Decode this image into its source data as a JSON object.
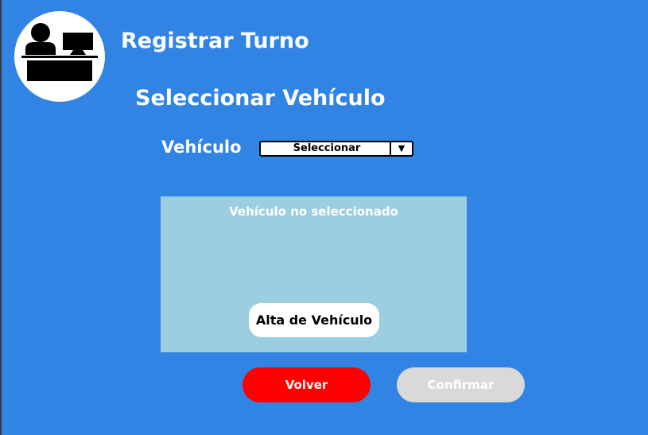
{
  "header": {
    "logo_icon": "receptionist-desk-icon",
    "title": "Registrar Turno"
  },
  "section": {
    "title": "Seleccionar Vehículo"
  },
  "vehicle_field": {
    "label": "Vehículo",
    "selected": "Seleccionar",
    "arrow": "▼"
  },
  "vehicle_panel": {
    "message": "Vehículo no seleccionado",
    "add_vehicle_label": "Alta de Vehículo"
  },
  "actions": {
    "back_label": "Volver",
    "confirm_label": "Confirmar"
  },
  "colors": {
    "background": "#3184e4",
    "panel": "#9bcfdf",
    "back_button": "#ff0000",
    "confirm_button_disabled": "#d9d9d9"
  }
}
